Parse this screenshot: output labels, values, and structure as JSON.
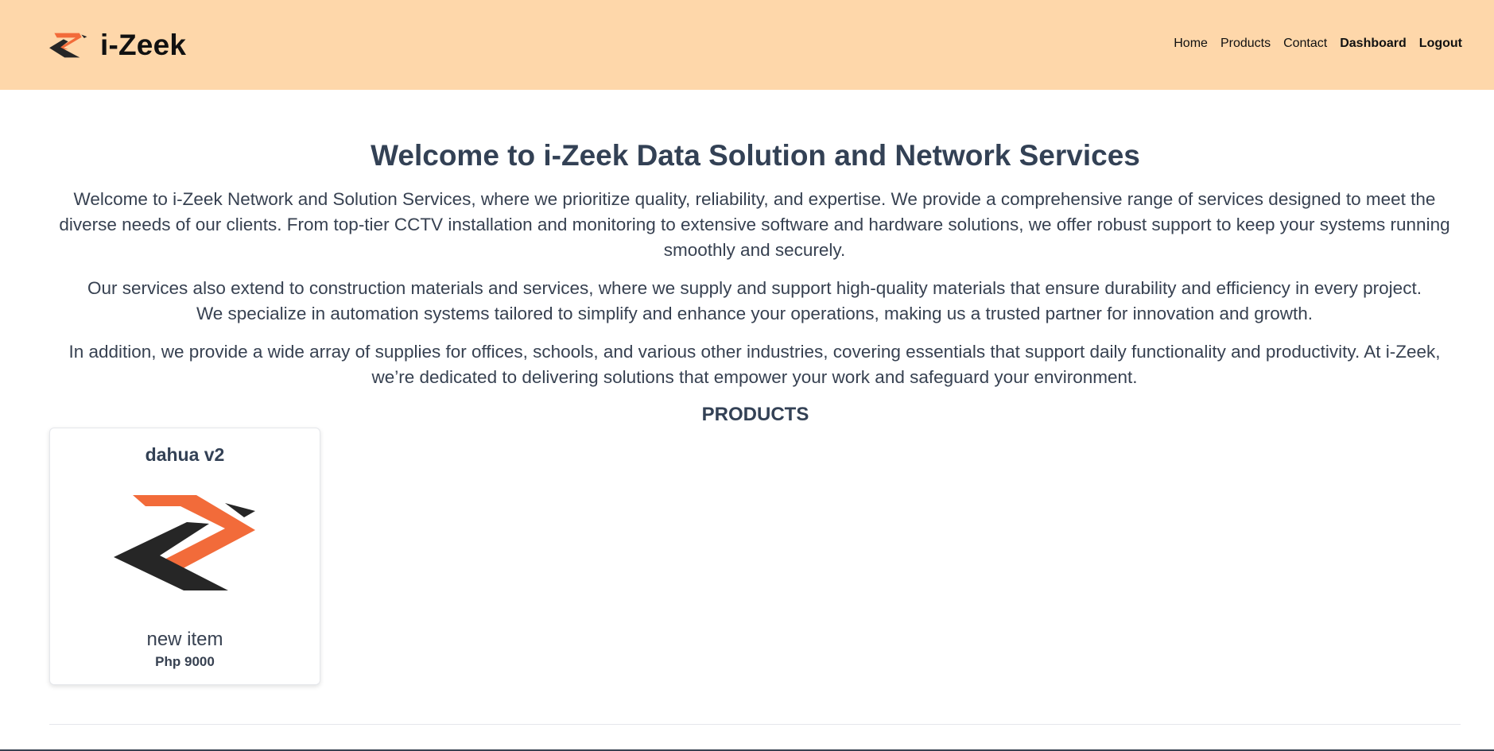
{
  "header": {
    "brand_name": "i-Zeek",
    "logo_icon": "i-zeek-logo-icon",
    "nav": {
      "home": "Home",
      "products": "Products",
      "contact": "Contact",
      "dashboard": "Dashboard",
      "logout": "Logout"
    }
  },
  "hero": {
    "title": "Welcome to i-Zeek Data Solution and Network Services",
    "paragraphs": [
      "Welcome to i-Zeek Network and Solution Services, where we prioritize quality, reliability, and expertise. We provide a comprehensive range of services designed to meet the diverse needs of our clients. From top-tier CCTV installation and monitoring to extensive software and hardware solutions, we offer robust support to keep your systems running smoothly and securely.",
      "Our services also extend to construction materials and services, where we supply and support high-quality materials that ensure durability and efficiency in every project. We specialize in automation systems tailored to simplify and enhance your operations, making us a trusted partner for innovation and growth.",
      "In addition, we provide a wide array of supplies for offices, schools, and various other industries, covering essentials that support daily functionality and productivity. At i-Zeek, we’re dedicated to delivering solutions that empower your work and safeguard your environment."
    ]
  },
  "products": {
    "heading": "PRODUCTS",
    "items": [
      {
        "name": "dahua v2",
        "description": "new item",
        "price": "Php 9000",
        "image_icon": "i-zeek-logo-icon"
      }
    ]
  },
  "colors": {
    "header_bg": "#fed7aa",
    "logo_orange": "#f26b3a",
    "logo_dark": "#262626",
    "text": "#374151",
    "heading": "#334155"
  }
}
